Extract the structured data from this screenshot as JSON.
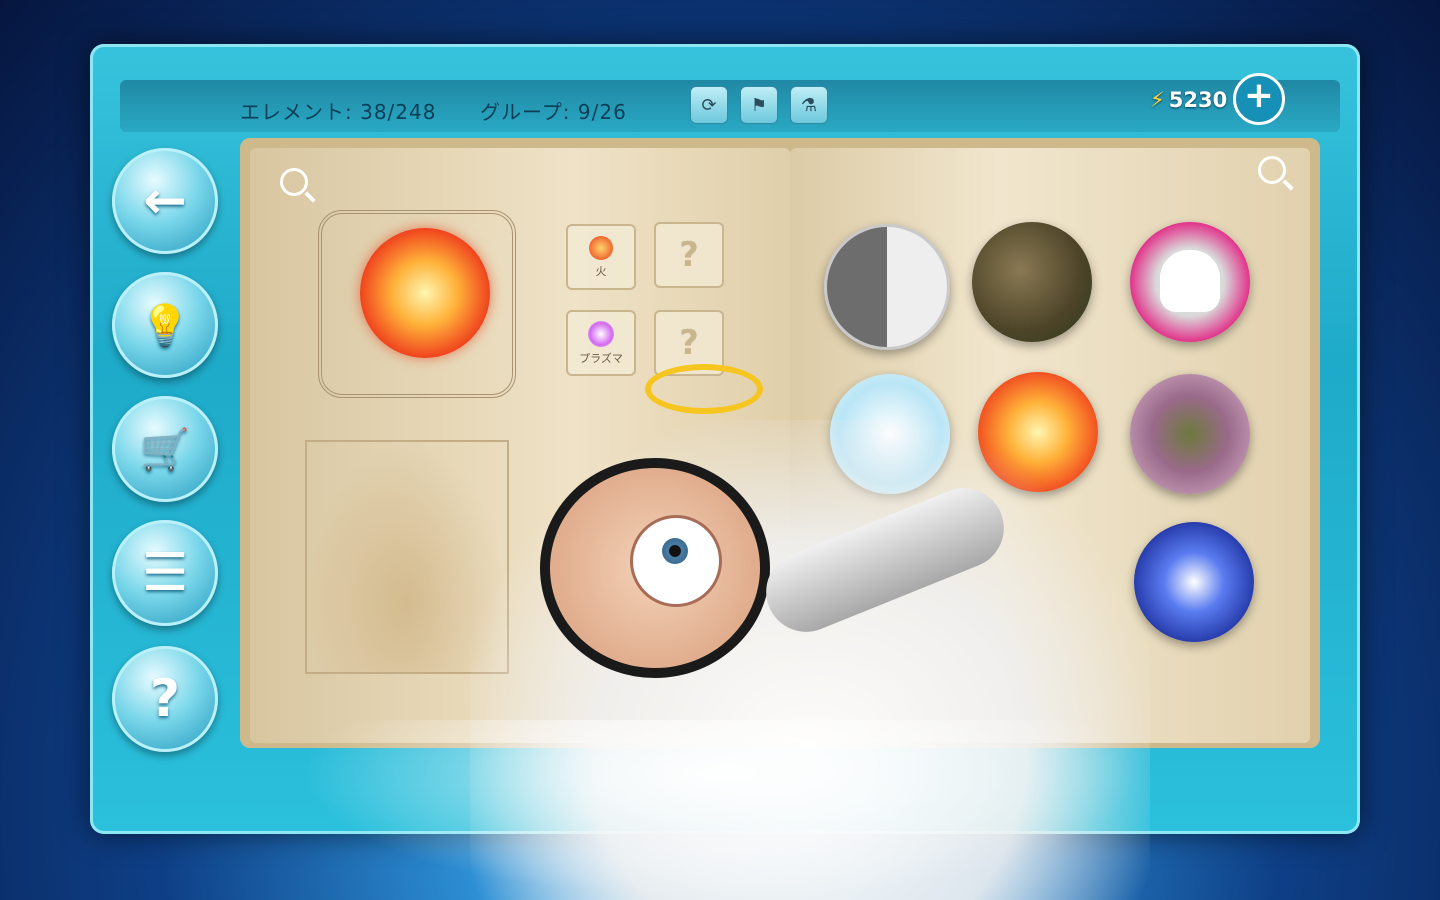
{
  "header": {
    "elements_label": "エレメント: 38/248",
    "groups_label": "グループ: 9/26",
    "currency": "5230",
    "plus_symbol": "+"
  },
  "toolbar": {
    "icons": [
      "reset-icon",
      "checkered-flag-icon",
      "potion-icon"
    ]
  },
  "sidebar": {
    "items": [
      {
        "name": "back-arrow-icon",
        "glyph": "←"
      },
      {
        "name": "hint-bulbs-icon",
        "glyph": "💡"
      },
      {
        "name": "shop-cart-icon",
        "glyph": "🛒"
      },
      {
        "name": "list-icon",
        "glyph": "☰"
      },
      {
        "name": "help-question-icon",
        "glyph": "?"
      }
    ]
  },
  "book": {
    "selected_element": "fire",
    "recipe_slots": [
      {
        "label": "火",
        "type": "element"
      },
      {
        "label": "?",
        "type": "unknown"
      },
      {
        "label": "プラズマ",
        "type": "element"
      },
      {
        "label": "?",
        "type": "unknown"
      }
    ],
    "right_page_elements": [
      "yin-yang",
      "stone",
      "skull",
      "air",
      "fire",
      "swamp",
      "water"
    ]
  },
  "colors": {
    "frame_accent": "#2bc0dc",
    "currency_bolt": "#ffd23a",
    "page_parchment": "#efe2c6"
  }
}
